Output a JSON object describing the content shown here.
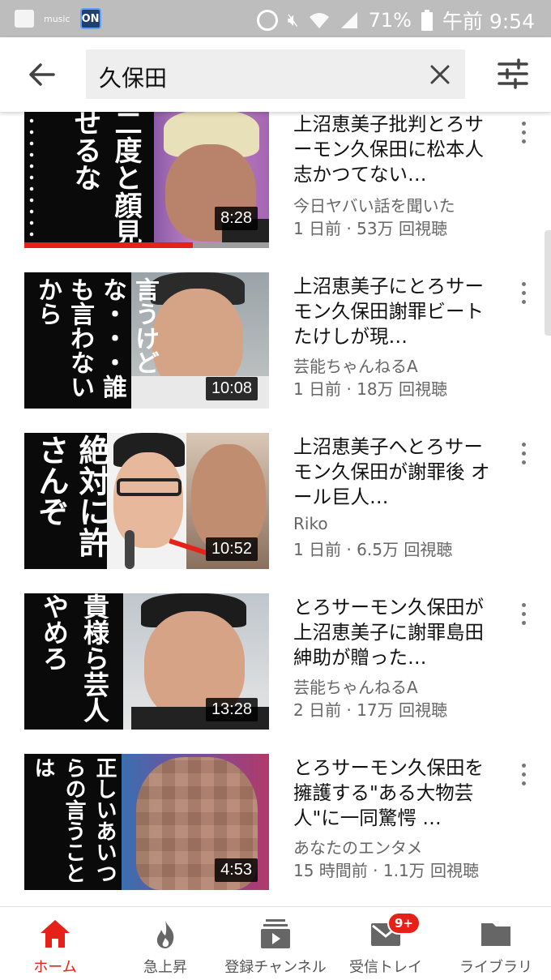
{
  "status_bar": {
    "music_label": "music",
    "on_label": "ON",
    "battery": "71%",
    "time": "午前 9:54",
    "icons": [
      "gallery-icon",
      "amazon-music-icon",
      "on-app-icon",
      "data-saver-icon",
      "mute-icon",
      "wifi-icon",
      "signal-icon",
      "battery-icon"
    ]
  },
  "header": {
    "query": "久保田",
    "icons": [
      "back-arrow-icon",
      "clear-icon",
      "filter-icon"
    ]
  },
  "results": [
    {
      "title": "上沼恵美子批判とろサーモン久保田に松本人志かつてない…",
      "channel": "今日ヤバい話を聞いた",
      "meta": "1 日前 · 53万 回視聴",
      "duration": "8:28",
      "overlay_text": "二度と顔見せるな",
      "watch_progress": 0.69
    },
    {
      "title": "上沼恵美子にとろサーモン久保田謝罪ビートたけしが現…",
      "channel": "芸能ちゃんねるA",
      "meta": "1 日前 · 18万 回視聴",
      "duration": "10:08",
      "overlay_text": "言うけどな・・・誰も言わないから"
    },
    {
      "title": "上沼恵美子へとろサーモン久保田が謝罪後 オール巨人…",
      "channel": "Riko",
      "meta": "1 日前 · 6.5万 回視聴",
      "duration": "10:52",
      "overlay_text": "絶対に許さんぞ"
    },
    {
      "title": "とろサーモン久保田が上沼恵美子に謝罪島田紳助が贈った…",
      "channel": "芸能ちゃんねるA",
      "meta": "2 日前 · 17万 回視聴",
      "duration": "13:28",
      "overlay_text": "貴様ら芸人やめろ"
    },
    {
      "title": "とろサーモン久保田を擁護する\"ある大物芸人\"に一同驚愕 …",
      "channel": "あなたのエンタメ",
      "meta": "15 時間前 · 1.1万 回視聴",
      "duration": "4:53",
      "overlay_text": "正しいあいつらの言うことは"
    }
  ],
  "bottom_nav": {
    "items": [
      {
        "label": "ホーム",
        "icon": "home-icon",
        "active": true
      },
      {
        "label": "急上昇",
        "icon": "trending-icon",
        "active": false
      },
      {
        "label": "登録チャンネル",
        "icon": "subscriptions-icon",
        "active": false
      },
      {
        "label": "受信トレイ",
        "icon": "inbox-icon",
        "active": false,
        "badge": "9+"
      },
      {
        "label": "ライブラリ",
        "icon": "library-icon",
        "active": false
      }
    ]
  },
  "colors": {
    "accent": "#e62117",
    "status_bar": "#bdbdbd",
    "search_box": "#eeeeee",
    "secondary_text": "#666666"
  }
}
